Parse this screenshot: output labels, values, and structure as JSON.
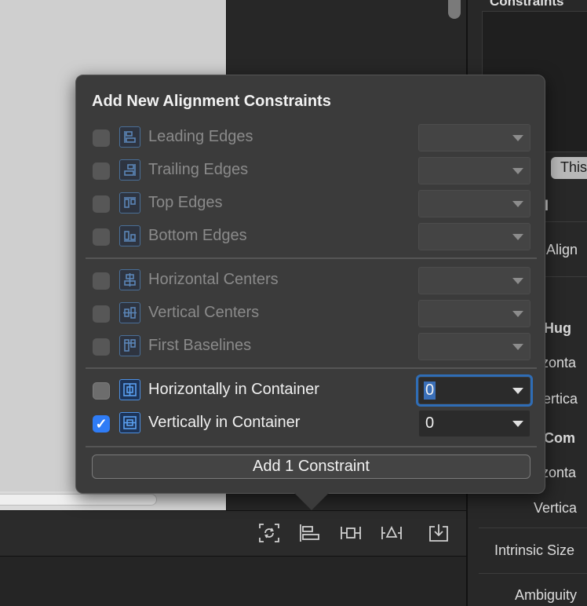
{
  "popover": {
    "title": "Add New Alignment Constraints",
    "group1": [
      {
        "label": "Leading Edges",
        "icon": "leading-edges-icon",
        "checked": false,
        "enabled": false,
        "value": ""
      },
      {
        "label": "Trailing Edges",
        "icon": "trailing-edges-icon",
        "checked": false,
        "enabled": false,
        "value": ""
      },
      {
        "label": "Top Edges",
        "icon": "top-edges-icon",
        "checked": false,
        "enabled": false,
        "value": ""
      },
      {
        "label": "Bottom Edges",
        "icon": "bottom-edges-icon",
        "checked": false,
        "enabled": false,
        "value": ""
      }
    ],
    "group2": [
      {
        "label": "Horizontal Centers",
        "icon": "horizontal-centers-icon",
        "checked": false,
        "enabled": false,
        "value": ""
      },
      {
        "label": "Vertical Centers",
        "icon": "vertical-centers-icon",
        "checked": false,
        "enabled": false,
        "value": ""
      },
      {
        "label": "First Baselines",
        "icon": "first-baselines-icon",
        "checked": false,
        "enabled": false,
        "value": ""
      }
    ],
    "group3": [
      {
        "label": "Horizontally in Container",
        "icon": "horizontally-in-container-icon",
        "checked": false,
        "enabled": true,
        "value": "0"
      },
      {
        "label": "Vertically in Container",
        "icon": "vertically-in-container-icon",
        "checked": true,
        "enabled": true,
        "value": "0"
      }
    ],
    "add_button_label": "Add 1 Constraint",
    "checkmark": "✓"
  },
  "inspector": {
    "title": "Constraints",
    "tab_pill": "This",
    "section1": "l",
    "align_label": "Align",
    "hugging_heading": "t Hug",
    "hugging_horizontal": "izonta",
    "hugging_vertical": "ertica",
    "compression_heading": "t Com",
    "compression_horizontal": "izonta",
    "compression_vertical": "Vertica",
    "intrinsic_size": "Intrinsic Size",
    "ambiguity": "Ambiguity"
  },
  "toolbar": {
    "buttons": [
      "update-frames-icon",
      "align-icon",
      "add-constraints-icon",
      "resolve-issues-icon",
      "embed-in-icon"
    ]
  },
  "colors": {
    "accent": "#2f7cf6",
    "popover_bg": "#3b3b3b",
    "icon_blue": "#4d8fe0"
  }
}
